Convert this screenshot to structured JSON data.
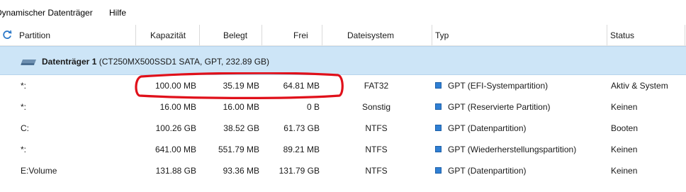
{
  "menu": {
    "item1": "Dynamischer Datenträger",
    "item2": "Hilfe"
  },
  "columns": {
    "partition": "Partition",
    "capacity": "Kapazität",
    "used": "Belegt",
    "free": "Frei",
    "filesystem": "Dateisystem",
    "type": "Typ",
    "status": "Status"
  },
  "disk": {
    "name": "Datenträger 1",
    "details": "(CT250MX500SSD1 SATA, GPT, 232.89 GB)"
  },
  "rows": [
    {
      "partition": "*:",
      "capacity": "100.00 MB",
      "used": "35.19 MB",
      "free": "64.81 MB",
      "fs": "FAT32",
      "type": "GPT (EFI-Systempartition)",
      "status": "Aktiv & System"
    },
    {
      "partition": "*:",
      "capacity": "16.00 MB",
      "used": "16.00 MB",
      "free": "0 B",
      "fs": "Sonstig",
      "type": "GPT (Reservierte Partition)",
      "status": "Keinen"
    },
    {
      "partition": "C:",
      "capacity": "100.26 GB",
      "used": "38.52 GB",
      "free": "61.73 GB",
      "fs": "NTFS",
      "type": "GPT (Datenpartition)",
      "status": "Booten"
    },
    {
      "partition": "*:",
      "capacity": "641.00 MB",
      "used": "551.79 MB",
      "free": "89.21 MB",
      "fs": "NTFS",
      "type": "GPT (Wiederherstellungspartition)",
      "status": "Keinen"
    },
    {
      "partition": "E:Volume",
      "capacity": "131.88 GB",
      "used": "93.36 MB",
      "free": "131.79 GB",
      "fs": "NTFS",
      "type": "GPT (Datenpartition)",
      "status": "Keinen"
    }
  ],
  "colors": {
    "disk_row_bg": "#cde5f7",
    "annotation": "#e0101a",
    "type_icon": "#2f7fd4"
  },
  "icons": {
    "refresh": "refresh-icon",
    "disk": "disk-icon",
    "partition_type": "partition-type-icon"
  }
}
